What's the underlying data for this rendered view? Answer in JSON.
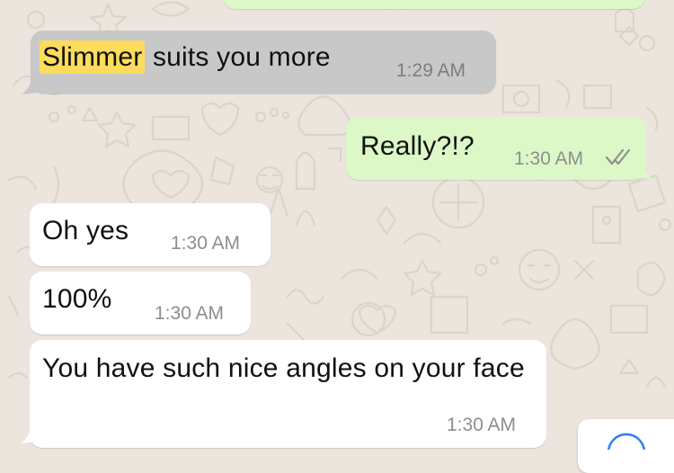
{
  "messages": [
    {
      "direction": "incoming",
      "selected": true,
      "highlight": "Slimmer",
      "text_rest": " suits you more",
      "time": "1:29 AM"
    },
    {
      "direction": "outgoing",
      "text": "Really?!?",
      "time": "1:30 AM",
      "status": "read-double-check-icon"
    },
    {
      "direction": "incoming",
      "text": "Oh yes",
      "time": "1:30 AM"
    },
    {
      "direction": "incoming",
      "text": "100%",
      "time": "1:30 AM"
    },
    {
      "direction": "incoming",
      "text": "You have such nice angles on your face",
      "time": "1:30 AM"
    }
  ],
  "colors": {
    "wallpaper": "#ece5dd",
    "incoming_bubble": "#ffffff",
    "incoming_selected_bubble": "#c8c8c8",
    "outgoing_bubble": "#dcf8c6",
    "search_highlight": "#fddc5c",
    "timestamp": "#8e8e8e",
    "read_ticks": "#8e8e8e"
  }
}
